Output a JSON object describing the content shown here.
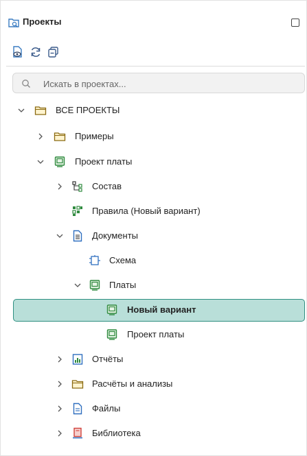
{
  "panel": {
    "title": "Проекты",
    "header_icon": "projects-search-icon"
  },
  "toolbar": {
    "buttons": [
      {
        "name": "view-options-button",
        "icon": "eye-document-icon"
      },
      {
        "name": "refresh-button",
        "icon": "refresh-icon"
      },
      {
        "name": "collapse-all-button",
        "icon": "collapse-icon"
      }
    ]
  },
  "search": {
    "placeholder": "Искать в проектах...",
    "value": ""
  },
  "tree": {
    "items": [
      {
        "label": "ВСЕ ПРОЕКТЫ",
        "icon": "folder-icon"
      },
      {
        "label": "Примеры",
        "icon": "folder-icon"
      },
      {
        "label": "Проект платы",
        "icon": "pcb-project-icon"
      },
      {
        "label": "Состав",
        "icon": "hierarchy-icon"
      },
      {
        "label": "Правила (Новый вариант)",
        "icon": "rules-icon"
      },
      {
        "label": "Документы",
        "icon": "document-icon"
      },
      {
        "label": "Схема",
        "icon": "schematic-icon"
      },
      {
        "label": "Платы",
        "icon": "board-icon"
      },
      {
        "label": "Новый вариант",
        "icon": "board-variant-icon",
        "selected": true
      },
      {
        "label": "Проект платы",
        "icon": "board-variant-icon"
      },
      {
        "label": "Отчёты",
        "icon": "report-icon"
      },
      {
        "label": "Расчёты и анализы",
        "icon": "folder-icon"
      },
      {
        "label": "Файлы",
        "icon": "file-icon"
      },
      {
        "label": "Библиотека",
        "icon": "library-icon"
      }
    ]
  },
  "colors": {
    "selection_bg": "#b9dfd9",
    "selection_border": "#2d8e80",
    "folder": "#c9a227",
    "green": "#2f8a3e",
    "blue": "#2f6fbf",
    "red": "#d0413b"
  }
}
